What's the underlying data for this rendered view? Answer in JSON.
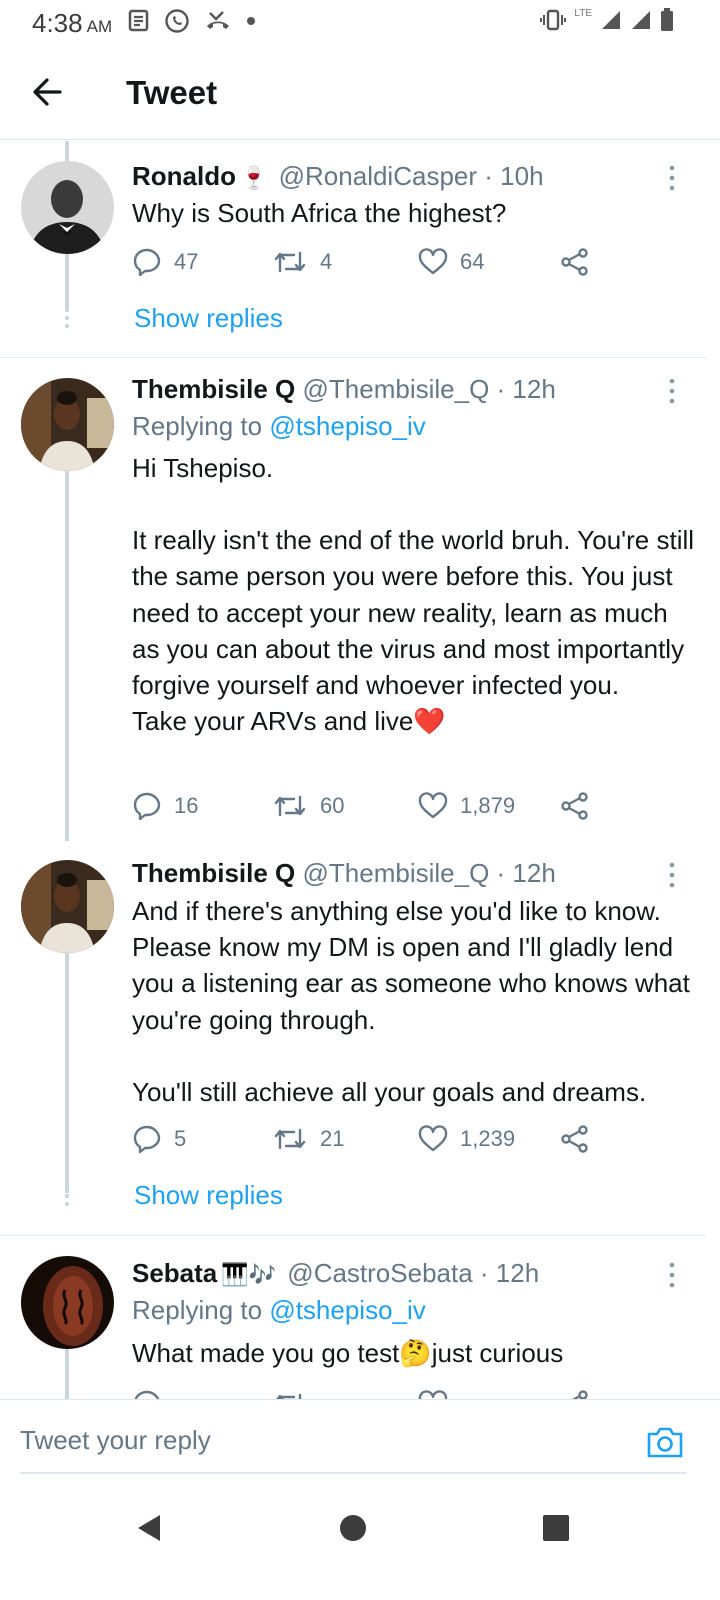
{
  "status_bar": {
    "time": "4:38",
    "ampm": "AM",
    "network": "LTE"
  },
  "header": {
    "title": "Tweet"
  },
  "tweets": [
    {
      "name": "Ronaldo",
      "name_emoji": "🍷",
      "handle": "@RonaldiCasper",
      "time": "· 10h",
      "text": [
        "Why is South Africa the highest?"
      ],
      "replies": "47",
      "retweets": "4",
      "likes": "64",
      "show_replies": "Show replies"
    },
    {
      "name": "Thembisile Q",
      "handle": "@Thembisile_Q",
      "time": "· 12h",
      "replying_label": "Replying to",
      "replying_to": "@tshepiso_iv",
      "text": [
        "Hi Tshepiso.",
        "It really isn't the end of the world bruh. You're still the same person you were before this. You just need to accept your new reality, learn as much as you can about the virus and most importantly forgive yourself and whoever infected you.",
        "Take your ARVs and live❤️"
      ],
      "replies": "16",
      "retweets": "60",
      "likes": "1,879"
    },
    {
      "name": "Thembisile Q",
      "handle": "@Thembisile_Q",
      "time": "· 12h",
      "text": [
        "And if there's anything else you'd like to know. Please know my DM is open and I'll gladly lend you a listening ear as someone who knows what you're going through.",
        "You'll still achieve all your goals and dreams."
      ],
      "replies": "5",
      "retweets": "21",
      "likes": "1,239",
      "show_replies": "Show replies"
    },
    {
      "name": "Sebata",
      "name_emoji": "🎹🎶",
      "handle": "@CastroSebata",
      "time": "· 12h",
      "replying_label": "Replying to",
      "replying_to": "@tshepiso_iv",
      "text": [
        "What made you go test🤔just curious"
      ]
    }
  ],
  "reply_bar": {
    "placeholder": "Tweet your reply"
  },
  "icons": {
    "accent": "#1da1f2",
    "muted": "#657786",
    "back": "arrow-left-icon",
    "reply": "comment-icon",
    "retweet": "retweet-icon",
    "like": "heart-icon",
    "share": "share-icon",
    "more": "more-vertical-icon",
    "camera": "camera-icon"
  }
}
